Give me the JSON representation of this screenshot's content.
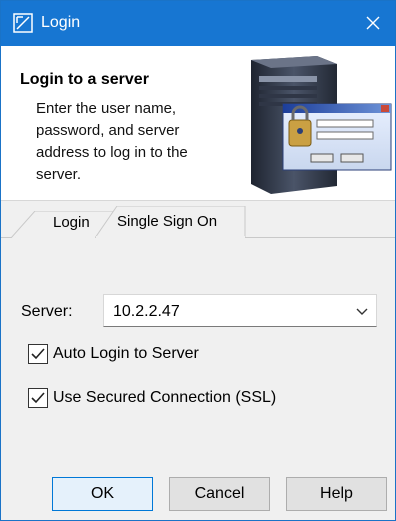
{
  "window": {
    "title": "Login",
    "accent_color": "#1776d2"
  },
  "header": {
    "title": "Login to a server",
    "description": "Enter the user name, password, and server address to log in to the server."
  },
  "tabs": [
    {
      "label": "Login",
      "selected": false
    },
    {
      "label": "Single Sign On",
      "selected": true
    }
  ],
  "form": {
    "server_label": "Server:",
    "server_value": "10.2.2.47",
    "auto_login": {
      "label": "Auto Login to Server",
      "checked": true
    },
    "secured": {
      "label": "Use Secured Connection (SSL)",
      "checked": true
    }
  },
  "buttons": {
    "ok": "OK",
    "cancel": "Cancel",
    "help": "Help"
  },
  "icons": {
    "window_icon": "app-logo-icon",
    "close": "close-icon",
    "dropdown": "chevron-down-icon",
    "check": "checkmark-icon"
  }
}
